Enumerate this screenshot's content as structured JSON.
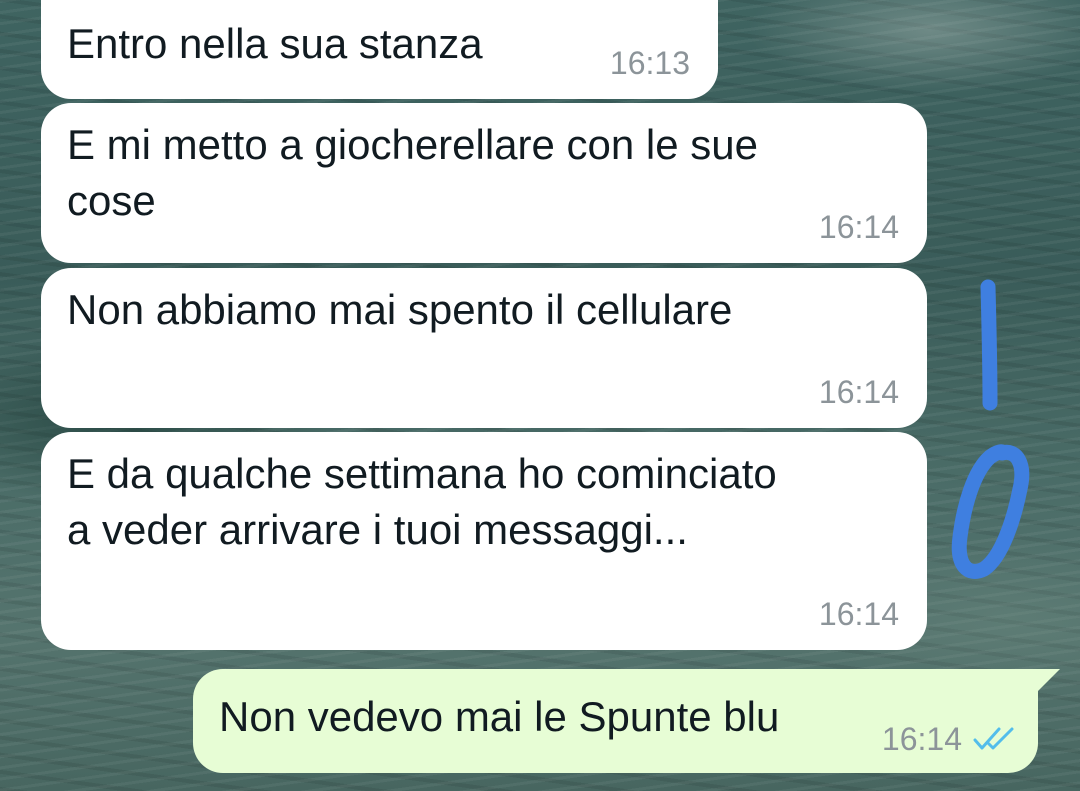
{
  "chat": {
    "messages": [
      {
        "direction": "incoming",
        "text": "Entro nella sua stanza",
        "time": "16:13"
      },
      {
        "direction": "incoming",
        "text": "E mi metto a giocherellare con le sue\ncose",
        "time": "16:14"
      },
      {
        "direction": "incoming",
        "text": "Non abbiamo mai spento il cellulare",
        "time": "16:14"
      },
      {
        "direction": "incoming",
        "text": "E da qualche settimana ho cominciato\na veder arrivare i tuoi messaggi...",
        "time": "16:14"
      }
    ],
    "outgoing": {
      "text": "Non vedevo mai le Spunte blu",
      "time": "16:14",
      "status_icon": "double-check-read-icon"
    }
  },
  "annotation": {
    "text": "10",
    "color": "#3f7fe0"
  },
  "colors": {
    "incoming_bubble": "#ffffff",
    "outgoing_bubble": "#e7fdd5",
    "timestamp": "#8c9499",
    "read_ticks": "#53bdeb"
  }
}
